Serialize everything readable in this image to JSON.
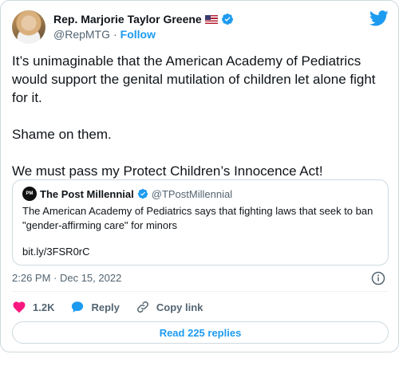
{
  "author": {
    "name": "Rep. Marjorie Taylor Greene",
    "handle": "@RepMTG",
    "separator": "·",
    "follow_label": "Follow"
  },
  "tweet": {
    "text": "It’s unimaginable that the American Academy of Pediatrics would support the genital mutilation of children let alone fight for it.\n\nShame on them.\n\nWe must pass my Protect Children’s Innocence Act!"
  },
  "quote": {
    "avatar_text": "PM",
    "name": "The Post Millennial",
    "handle": "@TPostMillennial",
    "text": "The American Academy of Pediatrics says that fighting laws that seek to ban \"gender-affirming care\" for minors",
    "link": "bit.ly/3FSR0rC"
  },
  "meta": {
    "timestamp": "2:26 PM · Dec 15, 2022"
  },
  "actions": {
    "likes": "1.2K",
    "reply_label": "Reply",
    "copy_label": "Copy link"
  },
  "read_replies_label": "Read 225 replies",
  "colors": {
    "accent": "#1d9bf0",
    "like": "#f91880",
    "text": "#0f1419",
    "muted": "#536471",
    "border": "#cfd9de"
  },
  "icons": [
    "verified-badge-icon",
    "twitter-bird-icon",
    "info-icon",
    "heart-icon",
    "reply-bubble-icon",
    "link-icon",
    "us-flag-icon"
  ]
}
